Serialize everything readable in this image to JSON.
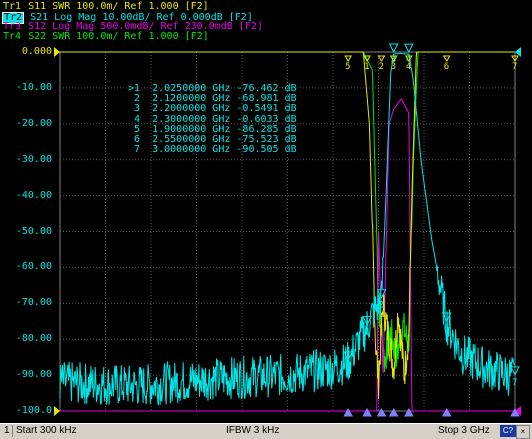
{
  "traces": [
    {
      "id": "Tr1",
      "param": "S11",
      "fmt": "SWR 100.0m/ Ref 1.000 [F2]",
      "color": "#e8e800",
      "active": false
    },
    {
      "id": "Tr2",
      "param": "S21",
      "fmt": "Log Mag 10.00dB/ Ref 0.000dB [F2]",
      "color": "#00e5e5",
      "active": true
    },
    {
      "id": "Tr3",
      "param": "S12",
      "fmt": "Log Mag 500.0mdB/ Ref 230.0mdB [F2]",
      "color": "#e800e8",
      "active": false
    },
    {
      "id": "Tr4",
      "param": "S22",
      "fmt": "SWR 100.0m/ Ref 1.000 [F2]",
      "color": "#00e800",
      "active": false
    }
  ],
  "y_axis": {
    "ticks": [
      "0.000",
      "-10.00",
      "-20.00",
      "-30.00",
      "-40.00",
      "-50.00",
      "-60.00",
      "-70.00",
      "-80.00",
      "-90.00",
      "-100.0"
    ]
  },
  "markers": [
    {
      "label": ">1",
      "freq": "2.0250000 GHz",
      "value": "-76.462",
      "unit": "dB"
    },
    {
      "label": "2",
      "freq": "2.1200000 GHz",
      "value": "-68.981",
      "unit": "dB"
    },
    {
      "label": "3",
      "freq": "2.2000000 GHz",
      "value": "-0.5491",
      "unit": "dB"
    },
    {
      "label": "4",
      "freq": "2.3000000 GHz",
      "value": "-0.6033",
      "unit": "dB"
    },
    {
      "label": "5",
      "freq": "1.9000000 GHz",
      "value": "-86.285",
      "unit": "dB"
    },
    {
      "label": "6",
      "freq": "2.5500000 GHz",
      "value": "-75.523",
      "unit": "dB"
    },
    {
      "label": "7",
      "freq": "3.0000000 GHz",
      "value": "-90.505",
      "unit": "dB"
    }
  ],
  "chart_data": {
    "type": "line",
    "x_start_ghz": 0.0003,
    "x_stop_ghz": 3.0,
    "ylim": [
      -100,
      0
    ],
    "grid": true,
    "series": [
      {
        "name": "S21",
        "color": "#00e5e5",
        "points": [
          [
            0.0003,
            -92
          ],
          [
            0.5,
            -93
          ],
          [
            1.0,
            -91
          ],
          [
            1.5,
            -90
          ],
          [
            1.8,
            -88
          ],
          [
            1.9,
            -86.3
          ],
          [
            1.98,
            -80
          ],
          [
            2.025,
            -76.5
          ],
          [
            2.06,
            -73
          ],
          [
            2.12,
            -69
          ],
          [
            2.15,
            -40
          ],
          [
            2.18,
            -6
          ],
          [
            2.2,
            -0.55
          ],
          [
            2.25,
            -0.4
          ],
          [
            2.3,
            -0.6
          ],
          [
            2.33,
            -8
          ],
          [
            2.38,
            -30
          ],
          [
            2.45,
            -52
          ],
          [
            2.55,
            -75.5
          ],
          [
            2.65,
            -84
          ],
          [
            2.8,
            -88
          ],
          [
            3.0,
            -90.5
          ]
        ]
      },
      {
        "name": "S11",
        "color": "#e8e800",
        "points": [
          [
            0.0003,
            0
          ],
          [
            2.0,
            0
          ],
          [
            2.04,
            -20
          ],
          [
            2.08,
            -80
          ],
          [
            2.1,
            -92
          ],
          [
            2.13,
            -70
          ],
          [
            2.17,
            -80
          ],
          [
            2.2,
            -88
          ],
          [
            2.23,
            -72
          ],
          [
            2.27,
            -90
          ],
          [
            2.3,
            -78
          ],
          [
            2.32,
            -40
          ],
          [
            2.35,
            0
          ],
          [
            3.0,
            0
          ]
        ]
      },
      {
        "name": "S12",
        "color": "#e800e8",
        "points": [
          [
            0.0003,
            -100
          ],
          [
            2.09,
            -100
          ],
          [
            2.1,
            -50
          ],
          [
            2.13,
            -90
          ],
          [
            2.17,
            -20
          ],
          [
            2.2,
            -16
          ],
          [
            2.25,
            -13
          ],
          [
            2.3,
            -17
          ],
          [
            2.32,
            -100
          ],
          [
            3.0,
            -100
          ]
        ]
      },
      {
        "name": "S22",
        "color": "#00e800",
        "points": [
          [
            0.0003,
            0
          ],
          [
            2.0,
            0
          ],
          [
            2.06,
            -5
          ],
          [
            2.1,
            -70
          ],
          [
            2.14,
            -86
          ],
          [
            2.18,
            -78
          ],
          [
            2.22,
            -85
          ],
          [
            2.26,
            -76
          ],
          [
            2.3,
            -82
          ],
          [
            2.33,
            -30
          ],
          [
            2.36,
            0
          ],
          [
            3.0,
            0
          ]
        ]
      }
    ]
  },
  "status": {
    "channel": "1",
    "start": "Start 300 kHz",
    "ifbw": "IFBW 3 kHz",
    "stop": "Stop 3 GHz",
    "c_label": "C?"
  }
}
